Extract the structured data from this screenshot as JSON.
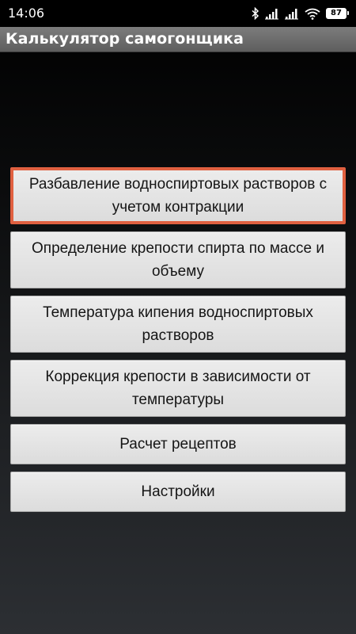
{
  "status_bar": {
    "time": "14:06",
    "battery": "87",
    "icons": [
      "bluetooth-icon",
      "signal-icon",
      "signal-icon",
      "wifi-icon",
      "battery-icon"
    ]
  },
  "app": {
    "title": "Калькулятор самогонщика"
  },
  "menu": {
    "items": [
      {
        "label": "Разбавление водноспиртовых растворов с учетом контракции"
      },
      {
        "label": "Определение крепости спирта по массе и объему"
      },
      {
        "label": "Температура кипения водноспиртовых растворов"
      },
      {
        "label": "Коррекция крепости в зависимости от температуры"
      },
      {
        "label": "Расчет рецептов"
      },
      {
        "label": "Настройки"
      }
    ]
  },
  "colors": {
    "focus_border": "#e06040",
    "button_bg": "#e4e4e4",
    "title_bar": "#6c6c6c"
  }
}
